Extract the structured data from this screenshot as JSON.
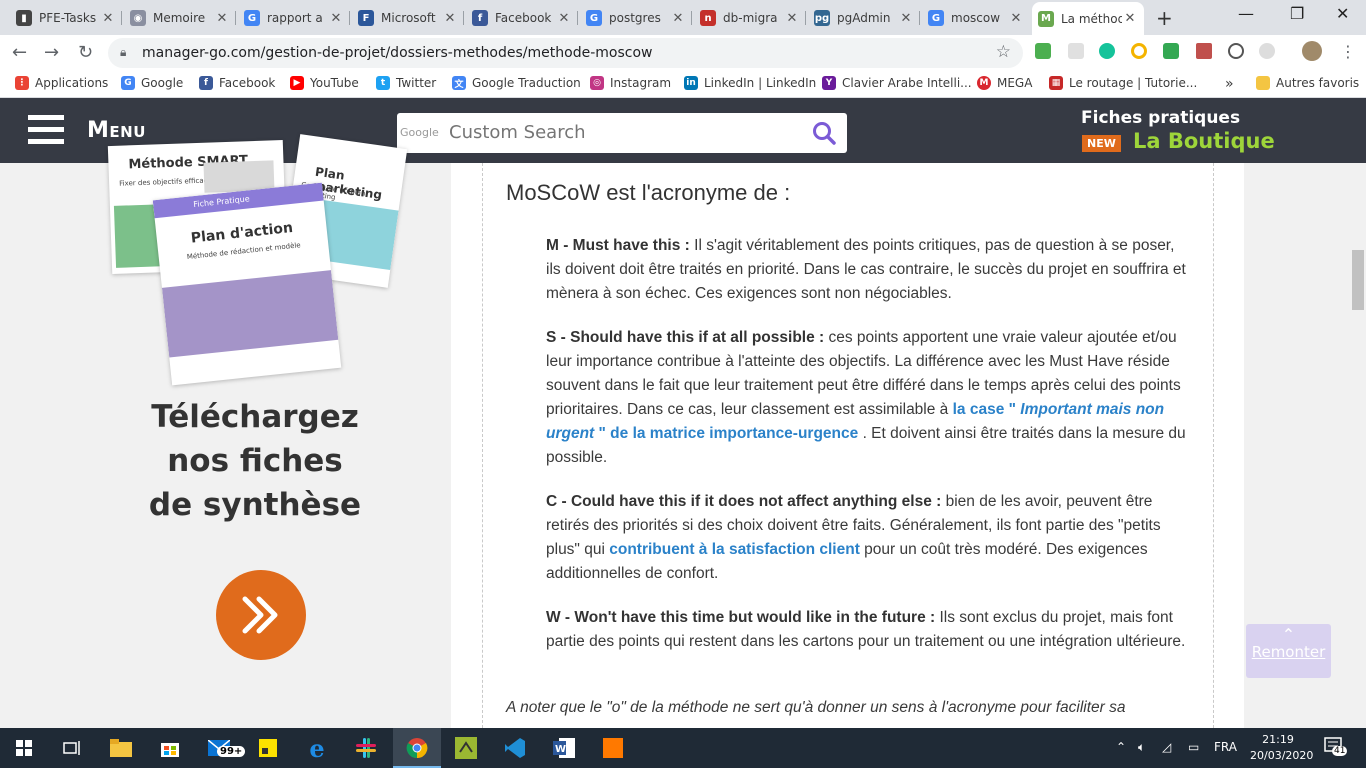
{
  "browser": {
    "tabs": [
      {
        "title": "PFE-Tasks",
        "color": "#444",
        "glyph": "▮"
      },
      {
        "title": "Memoire",
        "color": "#8a8fa0",
        "glyph": "◉"
      },
      {
        "title": "rapport a",
        "color": "#4285f4",
        "glyph": "G"
      },
      {
        "title": "Microsoft",
        "color": "#2b579a",
        "glyph": "F"
      },
      {
        "title": "Facebook",
        "color": "#3b5998",
        "glyph": "f"
      },
      {
        "title": "postgres",
        "color": "#4285f4",
        "glyph": "G"
      },
      {
        "title": "db-migra",
        "color": "#c4302b",
        "glyph": "n"
      },
      {
        "title": "pgAdmin",
        "color": "#336791",
        "glyph": "pg"
      },
      {
        "title": "moscow",
        "color": "#4285f4",
        "glyph": "G"
      },
      {
        "title": "La méthode",
        "color": "#6aa84f",
        "glyph": "M"
      }
    ],
    "url": "manager-go.com/gestion-de-projet/dossiers-methodes/methode-moscow",
    "bookmarks": [
      {
        "label": "Applications",
        "color": "#ea4335",
        "glyph": "⋮"
      },
      {
        "label": "Google",
        "color": "#4285f4",
        "glyph": "G"
      },
      {
        "label": "Facebook",
        "color": "#3b5998",
        "glyph": "f"
      },
      {
        "label": "YouTube",
        "color": "#ff0000",
        "glyph": "▶"
      },
      {
        "label": "Twitter",
        "color": "#1da1f2",
        "glyph": "t"
      },
      {
        "label": "Google Traduction",
        "color": "#4285f4",
        "glyph": "文"
      },
      {
        "label": "Instagram",
        "color": "#c13584",
        "glyph": "◎"
      },
      {
        "label": "LinkedIn | LinkedIn",
        "color": "#0077b5",
        "glyph": "in"
      },
      {
        "label": "Clavier Arabe Intelli...",
        "color": "#6a1b9a",
        "glyph": "Y"
      },
      {
        "label": "MEGA",
        "color": "#d9272e",
        "glyph": "M"
      },
      {
        "label": "Le routage | Tutorie...",
        "color": "#c62828",
        "glyph": "▦"
      },
      {
        "label": "Autres favoris",
        "color": "#f4c542",
        "glyph": ""
      }
    ],
    "more_chevron": "»"
  },
  "site": {
    "menu_label": "Menu",
    "search_logo": "Google",
    "search_placeholder": "Custom Search",
    "fiches_label": "Fiches pratiques",
    "new_badge": "NEW",
    "boutique_label": "La Boutique"
  },
  "sidebar": {
    "cards": [
      {
        "title": "Méthode SMART",
        "subtitle": "Fixer des objectifs efficacem"
      },
      {
        "title": "Plan marketing",
        "subtitle": "Construire un plan marketing"
      },
      {
        "title": "Plan d'action",
        "subtitle": "Méthode de rédaction et modèle",
        "tag": "Fiche Pratique"
      }
    ],
    "download_line1": "Téléchargez",
    "download_line2": "nos fiches",
    "download_line3": "de synthèse",
    "arrow_glyph": "»"
  },
  "article": {
    "heading": "MoSCoW est l'acronyme de :",
    "m_label": "M - Must have this :",
    "m_text": " Il s'agit véritablement des points critiques, pas de question à se poser, ils doivent doit être traités en priorité. Dans le cas contraire, le succès du projet en souffrira et mènera à son échec. Ces exigences sont non négociables.",
    "s_label": "S - Should have this if at all possible :",
    "s_text": " ces points apportent une vraie valeur ajoutée et/ou leur importance contribue à l'atteinte des objectifs. La différence avec les Must Have réside souvent dans le fait que leur traitement peut être différé dans le temps après celui des points prioritaires. Dans ce cas, leur classement est assimilable à ",
    "s_link_a": "la case  \" ",
    "s_link_i": "Important mais non urgent",
    "s_link_b": " \" de la matrice importance-urgence",
    "s_text_end": " . Et doivent ainsi être traités dans la mesure du possible.",
    "c_label": "C - Could have this if it does not affect anything else :",
    "c_text": " bien de les avoir, peuvent être retirés des priorités si des choix doivent être faits. Généralement, ils font partie des \"petits plus\" qui ",
    "c_link": "contribuent à la satisfaction client",
    "c_text_end": " pour un coût très modéré.  Des exigences additionnelles de confort.",
    "w_label": "W - Won't have this time but would like in the future :",
    "w_text": " Ils sont exclus du projet, mais font partie des points qui restent dans les cartons pour un traitement ou une intégration ultérieure.",
    "note": "A noter que le \"o\" de la méthode ne sert qu'à donner un sens à l'acronyme pour faciliter sa"
  },
  "remonter": {
    "chevron": "⌃",
    "label": "Remonter"
  },
  "taskbar": {
    "mail_badge": "99+",
    "language": "FRA",
    "time": "21:19",
    "date": "20/03/2020",
    "notif_count": "41"
  },
  "colors": {
    "header_bg": "#363a44",
    "accent_orange": "#e06b1c",
    "boutique_green": "#9ed53a",
    "link_blue": "#2b82c9",
    "taskbar_bg": "#1f2a36"
  }
}
